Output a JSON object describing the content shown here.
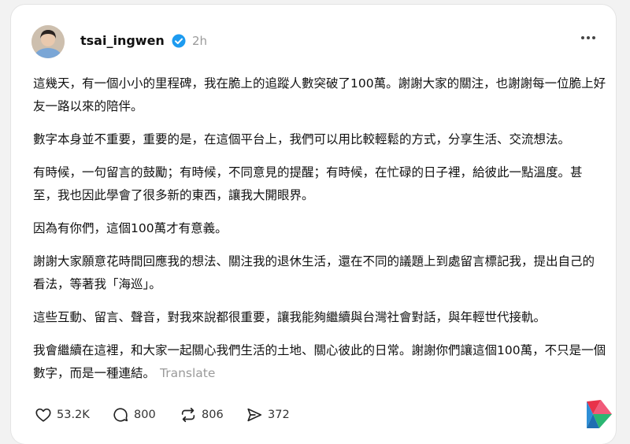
{
  "post": {
    "username": "tsai_ingwen",
    "time": "2h",
    "paragraphs": [
      "這幾天，有一個小小的里程碑，我在脆上的追蹤人數突破了100萬。謝謝大家的關注，也謝謝每一位脆上好友一路以來的陪伴。",
      "數字本身並不重要，重要的是，在這個平台上，我們可以用比較輕鬆的方式，分享生活、交流想法。",
      "有時候，一句留言的鼓勵；有時候，不同意見的提醒；有時候，在忙碌的日子裡，給彼此一點溫度。甚至，我也因此學會了很多新的東西，讓我大開眼界。",
      "因為有你們，這個100萬才有意義。",
      "謝謝大家願意花時間回應我的想法、關注我的退休生活，還在不同的議題上到處留言標記我，提出自己的看法，等著我「海巡」。",
      "這些互動、留言、聲音，對我來說都很重要，讓我能夠繼續與台灣社會對話，與年輕世代接軌。",
      "我會繼續在這裡，和大家一起關心我們生活的土地、關心彼此的日常。謝謝你們讓這個100萬，不只是一個數字，而是一種連結。"
    ],
    "translate_label": "Translate"
  },
  "actions": {
    "likes": "53.2K",
    "comments": "800",
    "reposts": "806",
    "shares": "372"
  },
  "icons": {
    "verified": "verified-badge-icon",
    "more": "more-options-icon",
    "like": "heart-icon",
    "comment": "comment-bubble-icon",
    "repost": "repost-icon",
    "share": "share-send-icon",
    "corner_logo": "colorful-logo-icon"
  },
  "colors": {
    "verified_blue": "#1d9bf0",
    "muted_text": "#9a9a9a",
    "logo_red": "#e8324a",
    "logo_green": "#2bb673",
    "logo_blue": "#2e8fd6"
  }
}
